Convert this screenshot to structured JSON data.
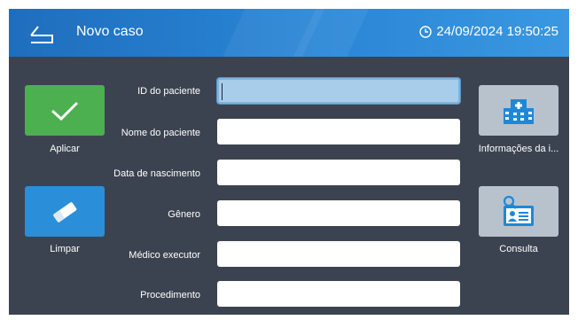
{
  "header": {
    "title": "Novo caso",
    "datetime": "24/09/2024 19:50:25",
    "back_icon": "back-arrow-icon",
    "clock_icon": "clock-icon"
  },
  "left_actions": {
    "apply_label": "Aplicar",
    "apply_icon": "checkmark-icon",
    "clear_label": "Limpar",
    "clear_icon": "eraser-icon"
  },
  "right_actions": {
    "institution_label": "Informações da i...",
    "institution_icon": "hospital-icon",
    "query_label": "Consulta",
    "query_icon": "id-card-search-icon"
  },
  "form": {
    "fields": [
      {
        "label": "ID do paciente",
        "value": "",
        "focused": true
      },
      {
        "label": "Nome do paciente",
        "value": ""
      },
      {
        "label": "Data de nascimento",
        "value": ""
      },
      {
        "label": "Gênero",
        "value": ""
      },
      {
        "label": "Médico executor",
        "value": ""
      },
      {
        "label": "Procedimento",
        "value": ""
      }
    ]
  },
  "colors": {
    "background": "#3c4350",
    "header": "#2a86d6",
    "apply_tile": "#4caf50",
    "clear_tile": "#2a8fd8",
    "side_tile": "#b8c2cc",
    "focused_field": "#a7cdea"
  }
}
